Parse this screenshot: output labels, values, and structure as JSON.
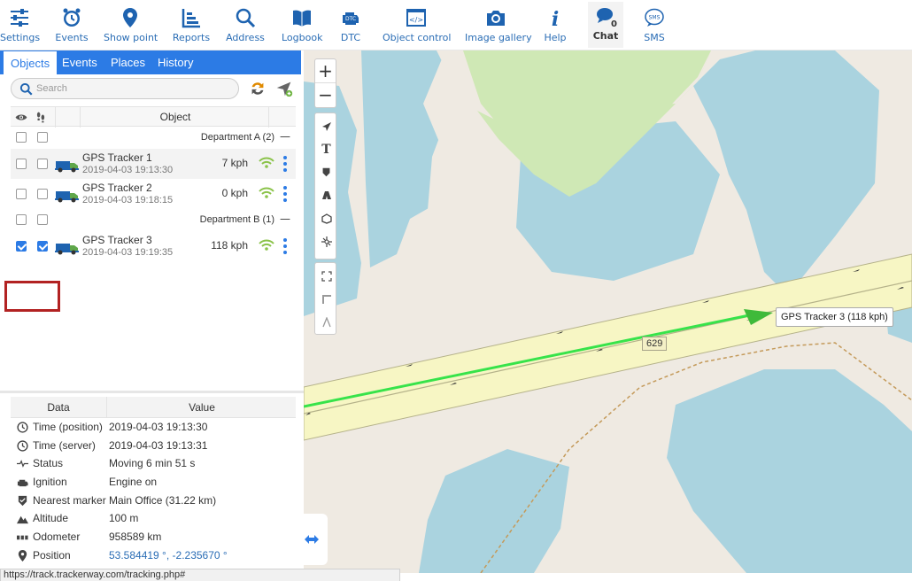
{
  "toolbar": {
    "items": [
      {
        "label": "Settings",
        "icon": "sliders-icon"
      },
      {
        "label": "Events",
        "icon": "alarm-clock-icon"
      },
      {
        "label": "Show point",
        "icon": "map-pin-icon"
      },
      {
        "label": "Reports",
        "icon": "bar-chart-icon"
      },
      {
        "label": "Address",
        "icon": "search-icon"
      },
      {
        "label": "Logbook",
        "icon": "book-icon"
      },
      {
        "label": "DTC",
        "icon": "engine-icon"
      },
      {
        "label": "Object control",
        "icon": "code-icon"
      },
      {
        "label": "Image gallery",
        "icon": "camera-icon"
      },
      {
        "label": "Help",
        "icon": "info-icon"
      },
      {
        "label": "Chat",
        "icon": "chat-icon",
        "count": "0"
      },
      {
        "label": "SMS",
        "icon": "sms-icon"
      }
    ],
    "accent": "#2a6db5"
  },
  "left_tabs": [
    "Objects",
    "Events",
    "Places",
    "History"
  ],
  "search": {
    "placeholder": "Search"
  },
  "objects": {
    "header": "Object",
    "groups": [
      {
        "name": "Department A (2)",
        "collapse": "—",
        "trackers": [
          {
            "name": "GPS Tracker 1",
            "time": "2019-04-03 19:13:30",
            "speed": "7 kph",
            "visible": false,
            "follow": false
          },
          {
            "name": "GPS Tracker 2",
            "time": "2019-04-03 19:18:15",
            "speed": "0 kph",
            "visible": false,
            "follow": false
          }
        ]
      },
      {
        "name": "Department B (1)",
        "collapse": "—",
        "trackers": [
          {
            "name": "GPS Tracker 3",
            "time": "2019-04-03 19:19:35",
            "speed": "118 kph",
            "visible": true,
            "follow": true
          }
        ]
      }
    ]
  },
  "details": {
    "col_data": "Data",
    "col_value": "Value",
    "rows": [
      {
        "label": "Time (position)",
        "value": "2019-04-03 19:13:30",
        "icon": "clock-icon"
      },
      {
        "label": "Time (server)",
        "value": "2019-04-03 19:13:31",
        "icon": "clock-icon"
      },
      {
        "label": "Status",
        "value": "Moving 6 min 51 s",
        "icon": "pulse-icon"
      },
      {
        "label": "Ignition",
        "value": "Engine on",
        "icon": "engine-icon"
      },
      {
        "label": "Nearest marker",
        "value": "Main Office (31.22 km)",
        "icon": "shield-icon"
      },
      {
        "label": "Altitude",
        "value": "100 m",
        "icon": "mountain-icon"
      },
      {
        "label": "Odometer",
        "value": "958589 km",
        "icon": "odometer-icon"
      },
      {
        "label": "Position",
        "value": "53.584419 °, -2.235670 °",
        "icon": "map-pin-icon",
        "link": true
      }
    ]
  },
  "map": {
    "marker_label": "GPS Tracker 3 (118 kph)",
    "road_label": "629",
    "zoom_in": "+",
    "zoom_out": "−"
  },
  "status_url": "https://track.trackerway.com/tracking.php#"
}
